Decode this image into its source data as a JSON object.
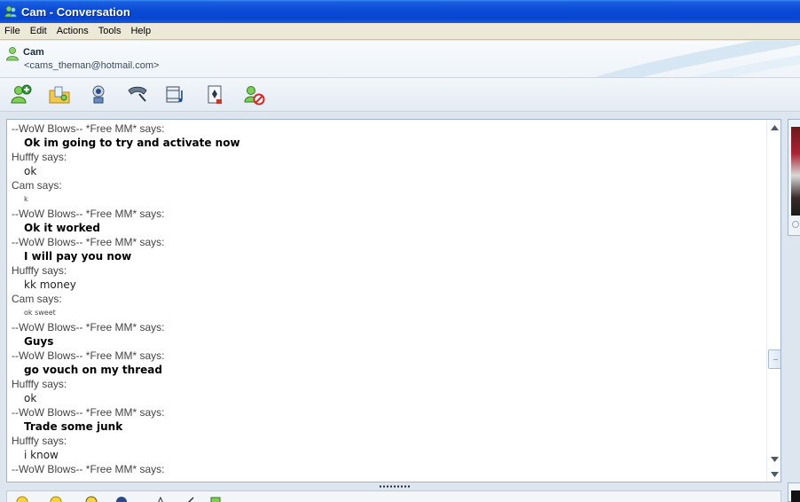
{
  "window": {
    "title": "Cam - Conversation"
  },
  "menu": [
    "File",
    "Edit",
    "Actions",
    "Tools",
    "Help"
  ],
  "contact": {
    "name": "Cam",
    "email": "<cams_theman@hotmail.com>"
  },
  "toolbar": {
    "icons": [
      "invite-contact-icon",
      "send-files-icon",
      "webcam-icon",
      "call-icon",
      "video-icon",
      "activities-icon",
      "block-icon"
    ]
  },
  "messages": [
    {
      "sender": "--WoW Blows-- *Free MM* says:",
      "text": "Ok im going to try and activate now",
      "style": "bold"
    },
    {
      "sender": "Hufffy says:",
      "text": "ok",
      "style": "plain"
    },
    {
      "sender": "Cam says:",
      "text": "k",
      "style": "tiny"
    },
    {
      "sender": "--WoW Blows-- *Free MM* says:",
      "text": "Ok it worked",
      "style": "bold"
    },
    {
      "sender": "--WoW Blows-- *Free MM* says:",
      "text": "I will pay you now",
      "style": "bold"
    },
    {
      "sender": "Hufffy says:",
      "text": "kk money",
      "style": "plain"
    },
    {
      "sender": "Cam says:",
      "text": "ok sweet",
      "style": "tiny"
    },
    {
      "sender": "--WoW Blows-- *Free MM* says:",
      "text": "Guys",
      "style": "bold"
    },
    {
      "sender": "--WoW Blows-- *Free MM* says:",
      "text": "go vouch on my thread",
      "style": "bold"
    },
    {
      "sender": "Hufffy says:",
      "text": "ok",
      "style": "plain"
    },
    {
      "sender": "--WoW Blows-- *Free MM* says:",
      "text": "Trade some junk",
      "style": "bold"
    },
    {
      "sender": "Hufffy says:",
      "text": "i know",
      "style": "plain"
    },
    {
      "sender": "--WoW Blows-- *Free MM* says:",
      "text": "",
      "style": "bold"
    }
  ],
  "scrollbar": {
    "position": 0.72
  },
  "colors": {
    "titlebar": "#0a4ad6",
    "menubar": "#ece9d8",
    "border": "#9fb4c9",
    "chat_bg": "#ffffff"
  }
}
